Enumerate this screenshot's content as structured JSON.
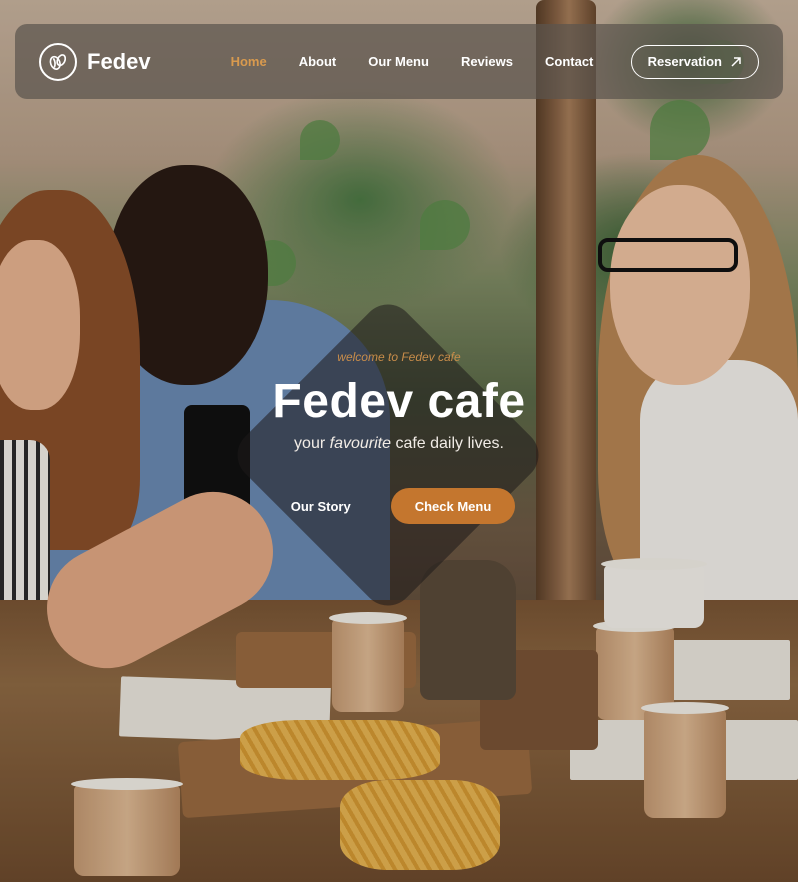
{
  "brand": {
    "name": "Fedev"
  },
  "nav": {
    "items": [
      {
        "label": "Home",
        "active": true
      },
      {
        "label": "About",
        "active": false
      },
      {
        "label": "Our Menu",
        "active": false
      },
      {
        "label": "Reviews",
        "active": false
      },
      {
        "label": "Contact",
        "active": false
      }
    ],
    "cta_label": "Reservation",
    "cta_icon": "arrow-up-right-icon"
  },
  "hero": {
    "welcome": "welcome to Fedev cafe",
    "title": "Fedev cafe",
    "tagline_before": "your ",
    "tagline_emph": "favourite",
    "tagline_after": " cafe daily lives.",
    "secondary_label": "Our Story",
    "primary_label": "Check Menu"
  },
  "colors": {
    "accent": "#c4762e",
    "active_nav": "#d99a4e",
    "welcome_text": "#c98d4a",
    "nav_background": "#5c544e"
  }
}
